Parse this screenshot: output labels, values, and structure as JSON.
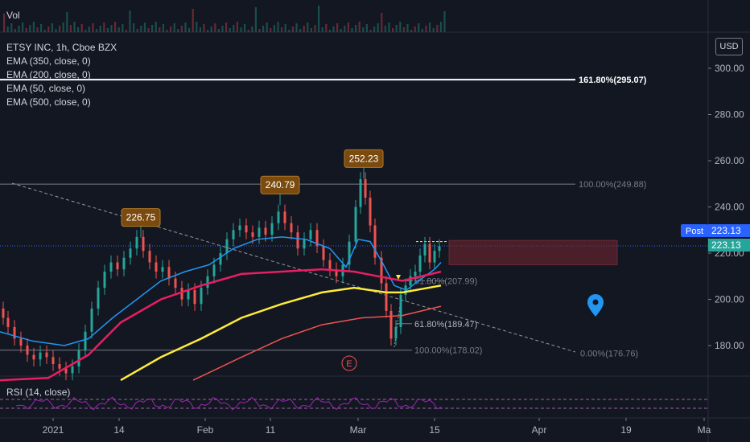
{
  "panels": {
    "volume_label": "Vol",
    "rsi_label": "RSI (14, close)",
    "currency": "USD"
  },
  "legend": {
    "title": "ETSY INC, 1h, Cboe BZX",
    "indicators": [
      "EMA (350, close, 0)",
      "EMA (200, close, 0)",
      "EMA (50, close, 0)",
      "EMA (500, close, 0)"
    ]
  },
  "chart_data": {
    "type": "line",
    "yaxis": {
      "ticks": [
        180,
        200,
        220,
        240,
        260,
        280,
        300
      ],
      "tick_labels": [
        "180.00",
        "200.00",
        "220.00",
        "240.00",
        "260.00",
        "280.00",
        "300.00"
      ],
      "ylim": [
        165,
        310
      ]
    },
    "xaxis": {
      "tick_labels": [
        "2021",
        "14",
        "Feb",
        "11",
        "Mar",
        "15",
        "Apr",
        "19",
        "Ma"
      ]
    },
    "price_path": [
      [
        0,
        196
      ],
      [
        6,
        192
      ],
      [
        12,
        188
      ],
      [
        20,
        183
      ],
      [
        28,
        180
      ],
      [
        36,
        176
      ],
      [
        44,
        174
      ],
      [
        52,
        177
      ],
      [
        60,
        175
      ],
      [
        68,
        172
      ],
      [
        76,
        170
      ],
      [
        84,
        168
      ],
      [
        92,
        171
      ],
      [
        100,
        178
      ],
      [
        108,
        186
      ],
      [
        116,
        196
      ],
      [
        124,
        205
      ],
      [
        132,
        212
      ],
      [
        140,
        216
      ],
      [
        148,
        213
      ],
      [
        156,
        218
      ],
      [
        164,
        222
      ],
      [
        172,
        227
      ],
      [
        180,
        221
      ],
      [
        188,
        216
      ],
      [
        196,
        212
      ],
      [
        204,
        214
      ],
      [
        212,
        209
      ],
      [
        220,
        205
      ],
      [
        228,
        200
      ],
      [
        236,
        204
      ],
      [
        244,
        198
      ],
      [
        252,
        205
      ],
      [
        260,
        210
      ],
      [
        268,
        215
      ],
      [
        276,
        220
      ],
      [
        284,
        226
      ],
      [
        292,
        230
      ],
      [
        300,
        232
      ],
      [
        308,
        229
      ],
      [
        316,
        227
      ],
      [
        324,
        231
      ],
      [
        332,
        228
      ],
      [
        340,
        233
      ],
      [
        348,
        238
      ],
      [
        356,
        233
      ],
      [
        364,
        229
      ],
      [
        372,
        222
      ],
      [
        380,
        226
      ],
      [
        388,
        230
      ],
      [
        396,
        223
      ],
      [
        404,
        217
      ],
      [
        412,
        213
      ],
      [
        420,
        210
      ],
      [
        428,
        215
      ],
      [
        436,
        225
      ],
      [
        444,
        240
      ],
      [
        450,
        252
      ],
      [
        456,
        244
      ],
      [
        462,
        232
      ],
      [
        468,
        218
      ],
      [
        476,
        207
      ],
      [
        482,
        195
      ],
      [
        488,
        183
      ],
      [
        494,
        188
      ],
      [
        500,
        202
      ],
      [
        506,
        206
      ],
      [
        512,
        210
      ],
      [
        518,
        212
      ],
      [
        524,
        219
      ],
      [
        530,
        224
      ],
      [
        536,
        216
      ],
      [
        542,
        221
      ],
      [
        548,
        223
      ]
    ],
    "series": [
      {
        "name": "EMA (50, close, 0)",
        "color": "#2196f3",
        "values": [
          [
            0,
            186
          ],
          [
            40,
            182
          ],
          [
            80,
            180
          ],
          [
            110,
            183
          ],
          [
            140,
            192
          ],
          [
            170,
            200
          ],
          [
            200,
            208
          ],
          [
            230,
            212
          ],
          [
            260,
            215
          ],
          [
            290,
            222
          ],
          [
            320,
            226
          ],
          [
            350,
            227
          ],
          [
            380,
            226
          ],
          [
            410,
            222
          ],
          [
            430,
            214
          ],
          [
            445,
            226
          ],
          [
            460,
            225
          ],
          [
            475,
            216
          ],
          [
            490,
            206
          ],
          [
            505,
            204
          ],
          [
            520,
            208
          ],
          [
            540,
            213
          ],
          [
            548,
            216
          ]
        ]
      },
      {
        "name": "EMA (200, close, 0)",
        "color": "#e91e63",
        "values": [
          [
            0,
            165
          ],
          [
            60,
            166
          ],
          [
            110,
            176
          ],
          [
            150,
            190
          ],
          [
            200,
            200
          ],
          [
            250,
            206
          ],
          [
            300,
            211
          ],
          [
            350,
            212
          ],
          [
            400,
            213
          ],
          [
            440,
            212
          ],
          [
            470,
            210
          ],
          [
            500,
            208
          ],
          [
            548,
            212
          ]
        ]
      },
      {
        "name": "EMA (350, close, 0)",
        "color": "#ffeb3b",
        "values": [
          [
            150,
            165
          ],
          [
            200,
            175
          ],
          [
            250,
            183
          ],
          [
            300,
            192
          ],
          [
            350,
            198
          ],
          [
            400,
            203
          ],
          [
            440,
            205
          ],
          [
            480,
            203
          ],
          [
            500,
            203
          ],
          [
            548,
            206
          ]
        ]
      },
      {
        "name": "EMA (500, close, 0)",
        "color": "#ef5350",
        "values": [
          [
            240,
            165
          ],
          [
            300,
            175
          ],
          [
            350,
            183
          ],
          [
            400,
            189
          ],
          [
            450,
            192
          ],
          [
            500,
            193
          ],
          [
            548,
            197
          ]
        ]
      }
    ],
    "fibonacci_levels": [
      {
        "label": "161.80%(295.07)",
        "value": 295.07
      },
      {
        "label": "100.00%(249.88)",
        "value": 249.88
      },
      {
        "label": "61.80%(207.99)",
        "value": 207.99
      },
      {
        "label": "61.80%(189.47)",
        "value": 189.47
      },
      {
        "label": "100.00%(178.02)",
        "value": 178.02
      },
      {
        "label": "0.00%(176.76)",
        "value": 176.76
      }
    ],
    "peak_labels": [
      {
        "text": "226.75",
        "value": 226.75
      },
      {
        "text": "240.79",
        "value": 240.79
      },
      {
        "text": "252.23",
        "value": 252.23
      }
    ],
    "last_price": {
      "value": 223.13,
      "label": "223.13",
      "post_label": "Post",
      "post_value": "223.13"
    },
    "event_marker": "E",
    "colors": {
      "up": "#26a69a",
      "down": "#ef5350",
      "background": "#131722",
      "grid": "#2a2e39",
      "post": "#2962ff",
      "last": "#26a69a"
    }
  }
}
